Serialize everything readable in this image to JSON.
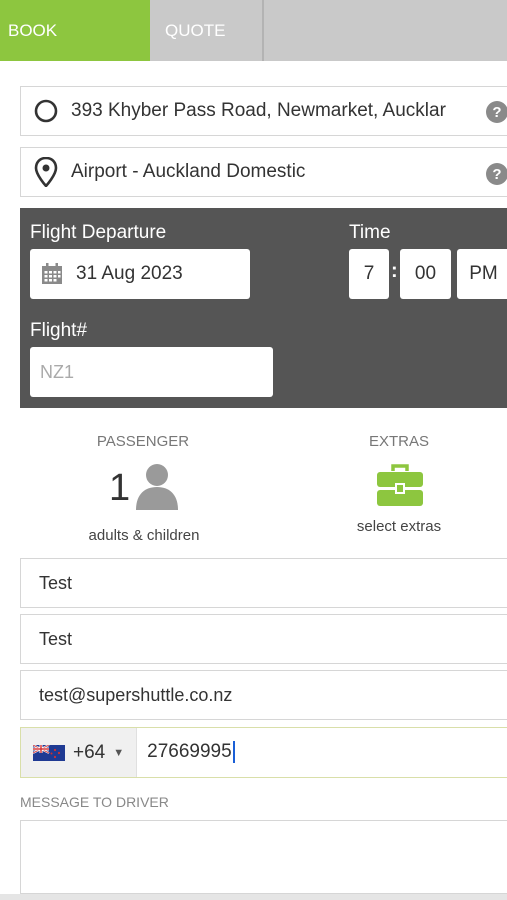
{
  "tabs": {
    "book": "BOOK",
    "quote": "QUOTE"
  },
  "pickup": {
    "address": "393 Khyber Pass Road, Newmarket, Aucklar",
    "icon": "circle-icon",
    "help": "?"
  },
  "dropoff": {
    "address": "Airport - Auckland Domestic",
    "icon": "map-pin-icon",
    "help": "?"
  },
  "flight": {
    "departure_label": "Flight Departure",
    "date": "31 Aug 2023",
    "time_label": "Time",
    "hour": "7",
    "minute": "00",
    "ampm": "PM",
    "colon": ":",
    "flight_no_label": "Flight#",
    "flight_no_placeholder": "NZ1"
  },
  "passenger": {
    "label": "PASSENGER",
    "count": "1",
    "sub": "adults & children"
  },
  "extras": {
    "label": "EXTRAS",
    "sub": "select extras"
  },
  "contact": {
    "first_name": "Test",
    "last_name": "Test",
    "email": "test@supershuttle.co.nz",
    "country_code": "+64",
    "phone": "27669995"
  },
  "message": {
    "label": "MESSAGE TO DRIVER",
    "value": ""
  },
  "colors": {
    "accent": "#8dc63f",
    "panel": "#555555",
    "tab_inactive": "#c9c9c9"
  }
}
